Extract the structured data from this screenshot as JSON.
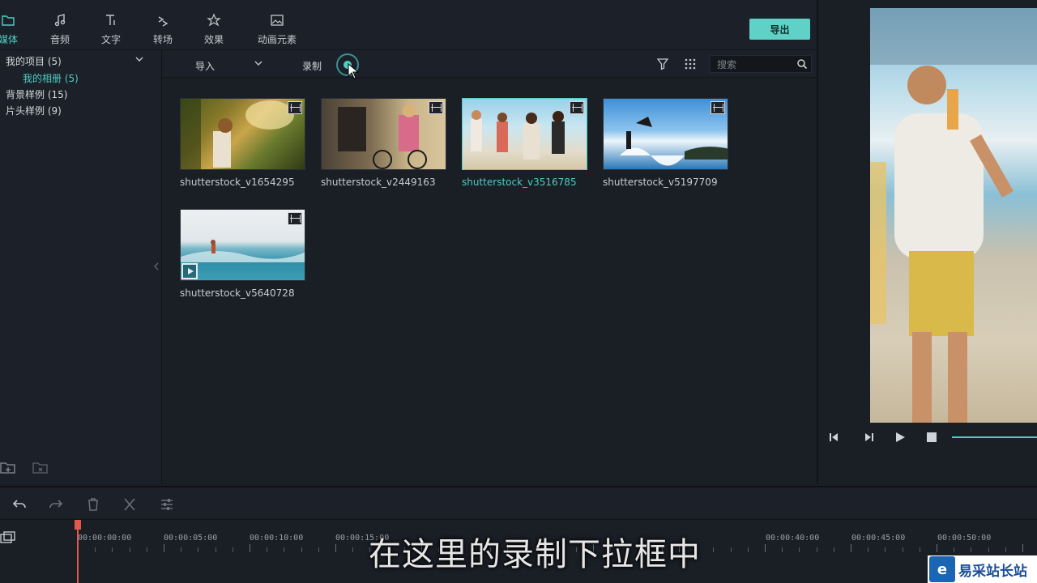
{
  "tabs": [
    {
      "label": "媒体",
      "icon": "folder-icon",
      "active": true
    },
    {
      "label": "音频",
      "icon": "music-note-icon"
    },
    {
      "label": "文字",
      "icon": "text-icon"
    },
    {
      "label": "转场",
      "icon": "transition-icon"
    },
    {
      "label": "效果",
      "icon": "effects-icon"
    },
    {
      "label": "动画元素",
      "icon": "image-icon"
    }
  ],
  "export_label": "导出",
  "sidebar": {
    "items": [
      {
        "label": "我的项目 (5)"
      },
      {
        "label": "我的相册 (5)"
      },
      {
        "label": "背景样例 (15)"
      },
      {
        "label": "片头样例 (9)"
      }
    ]
  },
  "toolbar": {
    "import_label": "导入",
    "record_label": "录制",
    "search_placeholder": "搜索"
  },
  "media": [
    {
      "name": "shutterstock_v1654295"
    },
    {
      "name": "shutterstock_v2449163"
    },
    {
      "name": "shutterstock_v3516785",
      "selected": true
    },
    {
      "name": "shutterstock_v5197709"
    },
    {
      "name": "shutterstock_v5640728"
    }
  ],
  "timeline": {
    "labels": [
      "00:00:00:00",
      "00:00:05:00",
      "00:00:10:00",
      "00:00:15:00",
      "00:00:40:00",
      "00:00:45:00",
      "00:00:50:00"
    ]
  },
  "subtitle": "在这里的录制下拉框中",
  "watermark": "易采站长站",
  "colors": {
    "accent": "#4ecdc4",
    "export_bg": "#5fd1c6",
    "playhead": "#e0594a"
  }
}
